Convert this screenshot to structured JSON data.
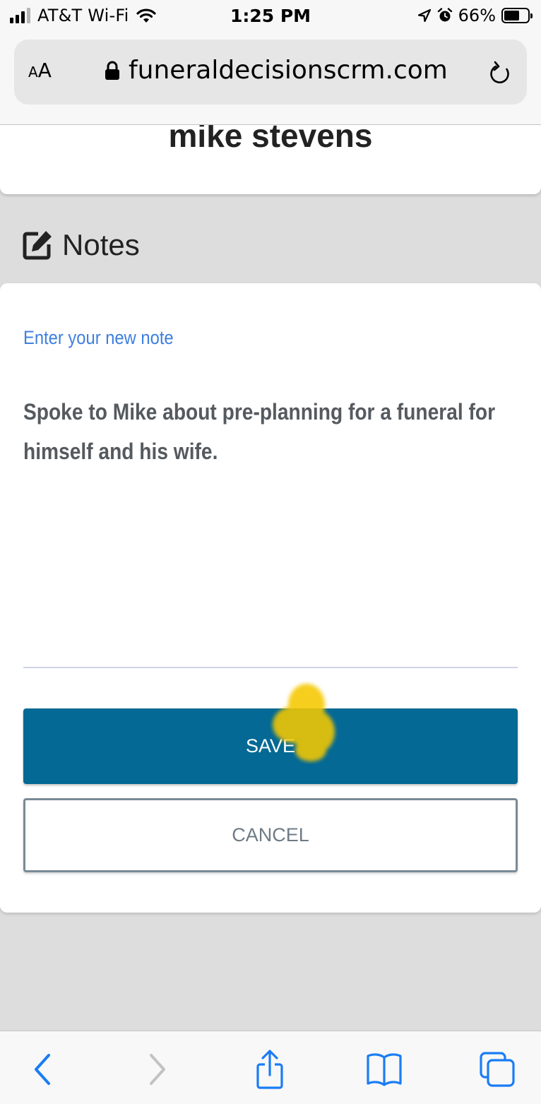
{
  "status_bar": {
    "carrier": "AT&T Wi-Fi",
    "time": "1:25 PM",
    "battery_percent": "66%",
    "battery_level": 0.66,
    "signal_bars_active": 3,
    "signal_bars_total": 4
  },
  "browser": {
    "text_size_label_small": "A",
    "text_size_label_large": "A",
    "domain": "funeraldecisionscrm.com"
  },
  "contact": {
    "name": "mike stevens"
  },
  "notes": {
    "title": "Notes",
    "field_label": "Enter your new note",
    "note_value": "Spoke to Mike about pre-planning for a funeral for himself and his wife.",
    "save_label": "SAVE",
    "cancel_label": "CANCEL"
  },
  "colors": {
    "accent_link": "#3e7fe0",
    "save_button": "#046994",
    "ios_blue": "#1a7cf5",
    "tap_indicator": "#f5c800"
  },
  "toolbar": {
    "icons": [
      "back-icon",
      "forward-icon",
      "share-icon",
      "bookmarks-icon",
      "tabs-icon"
    ]
  }
}
